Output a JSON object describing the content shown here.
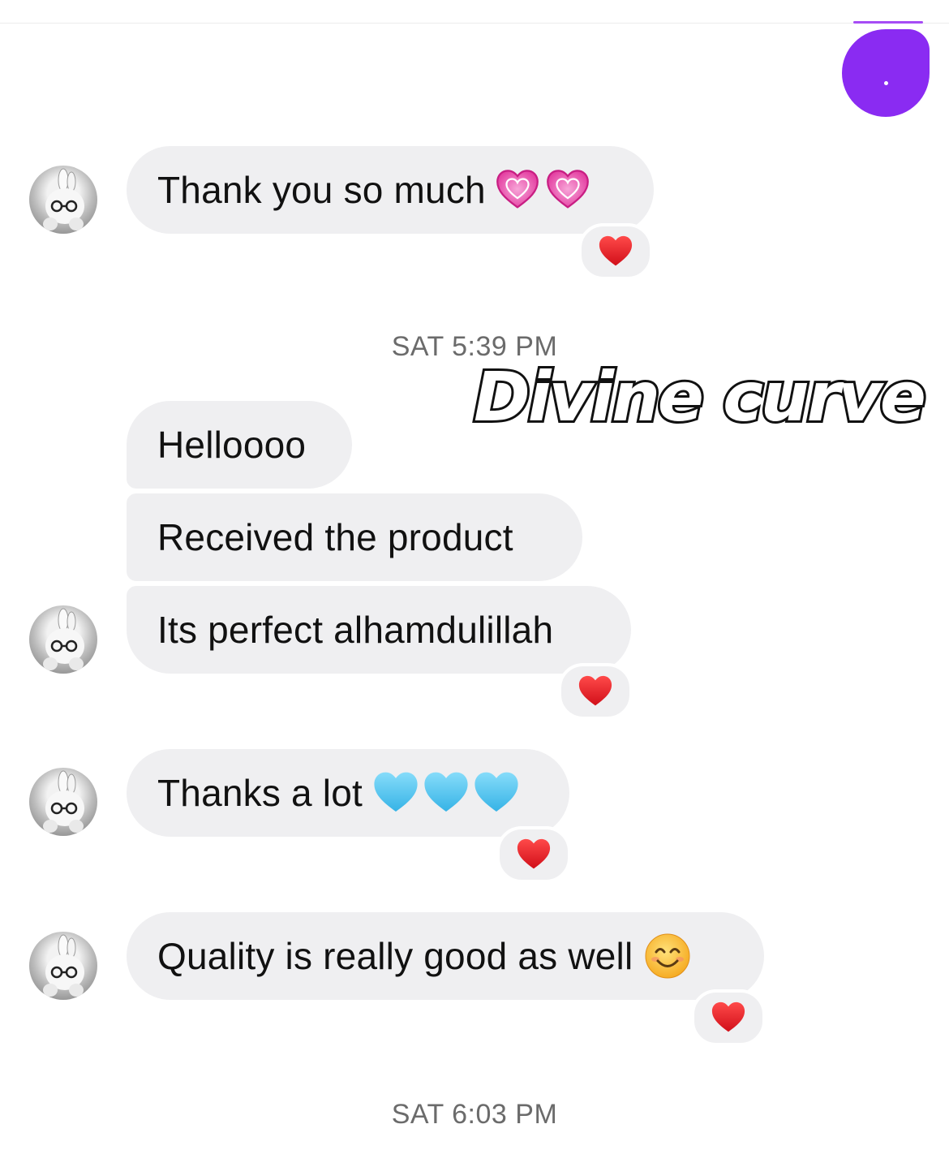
{
  "thread": {
    "messages": [
      {
        "text": "Thank you so much",
        "emoji": [
          "heart-pink",
          "heart-pink"
        ],
        "reaction": "heart-red"
      },
      {
        "text": "Helloooo"
      },
      {
        "text": "Received the product"
      },
      {
        "text": "Its perfect alhamdulillah",
        "reaction": "heart-red"
      },
      {
        "text": "Thanks a lot",
        "emoji": [
          "heart-blue",
          "heart-blue",
          "heart-blue"
        ],
        "reaction": "heart-red"
      },
      {
        "text": "Quality is really good as well",
        "emoji": [
          "smiling-face"
        ],
        "reaction": "heart-red"
      }
    ],
    "timestamps": [
      "SAT 5:39 PM",
      "SAT 6:03 PM"
    ]
  },
  "watermark": {
    "text": "Divine curve"
  },
  "colors": {
    "sent_bubble": "#8a2bf2",
    "received_bubble": "#efeff1",
    "heart_red": "#e5141c",
    "heart_pink": "#f05fb4",
    "heart_blue": "#5ccaf0",
    "timestamp_text": "#6b6b6b"
  }
}
